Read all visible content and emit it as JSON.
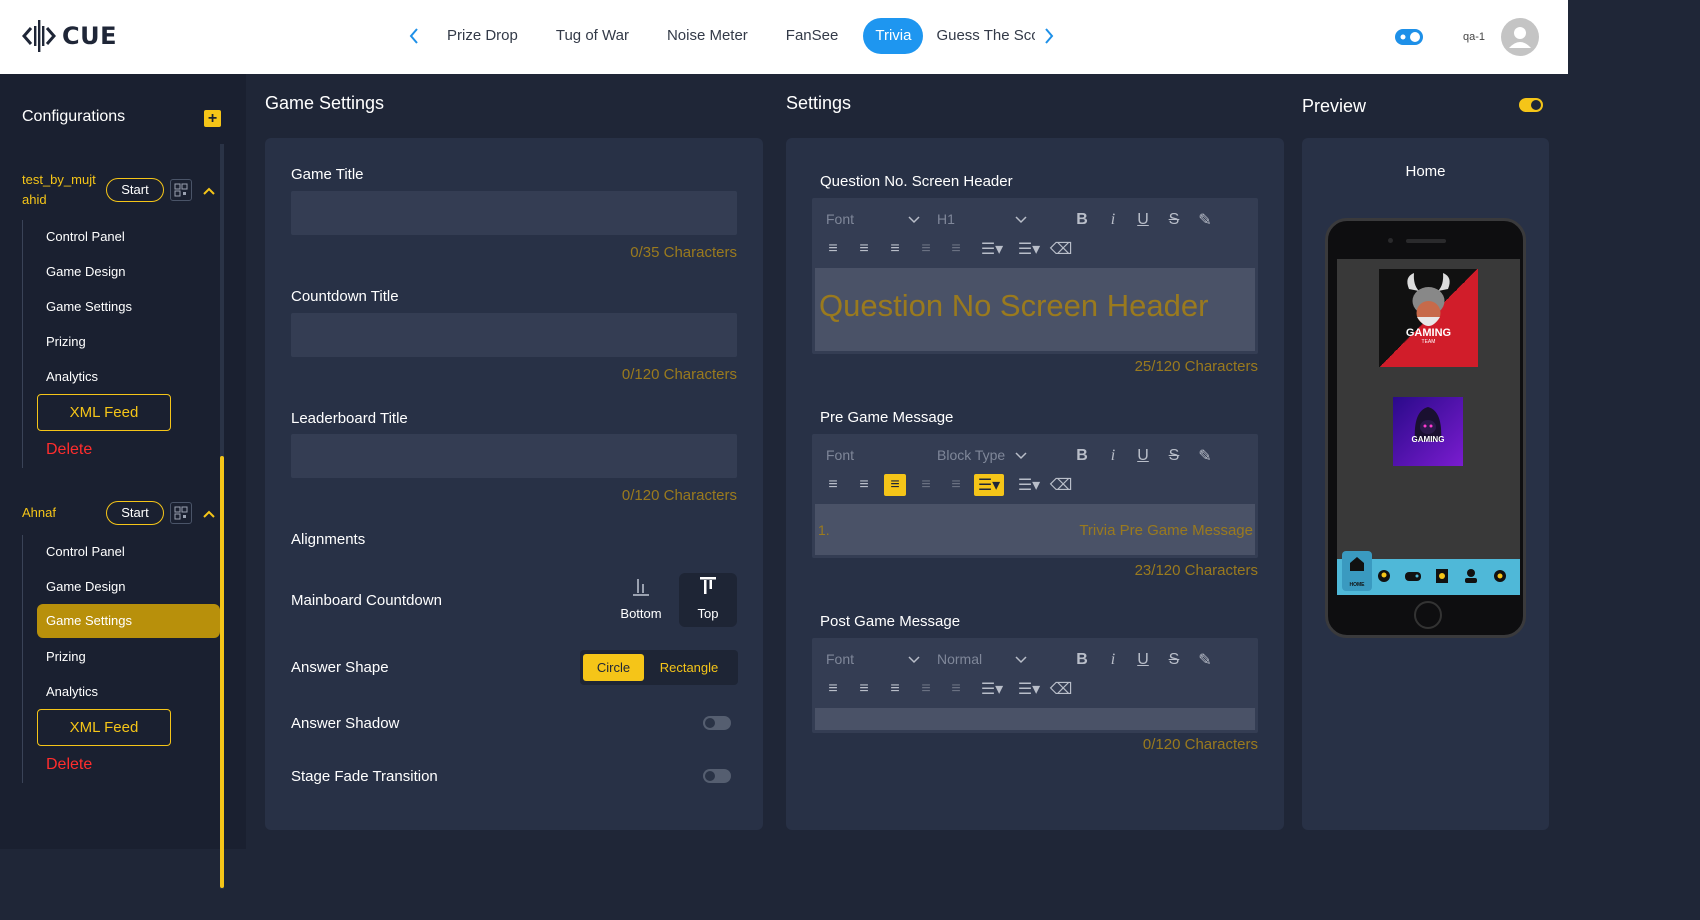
{
  "header": {
    "logo_text": "CUE",
    "tabs": [
      {
        "label": "Prize Drop"
      },
      {
        "label": "Tug of War"
      },
      {
        "label": "Noise Meter"
      },
      {
        "label": "FanSee"
      },
      {
        "label": "Trivia",
        "active": true
      },
      {
        "label": "Guess The Score"
      }
    ],
    "user": "qa-1",
    "accent": "#1e96f0"
  },
  "sidebar": {
    "title": "Configurations",
    "configs": [
      {
        "name": "test_by_mujt ahid",
        "name_line1": "test_by_mujt",
        "name_line2": "ahid",
        "start_label": "Start",
        "items": [
          "Control Panel",
          "Game Design",
          "Game Settings",
          "Prizing",
          "Analytics"
        ],
        "xml_label": "XML Feed",
        "delete_label": "Delete"
      },
      {
        "name": "Ahnaf",
        "start_label": "Start",
        "items": [
          "Control Panel",
          "Game Design",
          "Game Settings",
          "Prizing",
          "Analytics"
        ],
        "active_item": "Game Settings",
        "xml_label": "XML Feed",
        "delete_label": "Delete"
      }
    ]
  },
  "game_settings": {
    "title": "Game Settings",
    "game_title": {
      "label": "Game Title",
      "value": "",
      "count": "0/35 Characters"
    },
    "countdown_title": {
      "label": "Countdown Title",
      "value": "",
      "count": "0/120 Characters"
    },
    "leaderboard_title": {
      "label": "Leaderboard Title",
      "value": "",
      "count": "0/120 Characters"
    },
    "alignments_label": "Alignments",
    "mainboard_countdown": {
      "label": "Mainboard Countdown",
      "options": [
        "Bottom",
        "Top"
      ],
      "selected": "Top"
    },
    "answer_shape": {
      "label": "Answer Shape",
      "options": [
        "Circle",
        "Rectangle"
      ],
      "selected": "Circle"
    },
    "answer_shadow": {
      "label": "Answer Shadow",
      "enabled": false
    },
    "stage_fade": {
      "label": "Stage Fade Transition",
      "enabled": false
    }
  },
  "settings": {
    "title": "Settings",
    "question_header": {
      "label": "Question No. Screen Header",
      "font": "Font",
      "block": "H1",
      "content": "Question No Screen Header",
      "count": "25/120 Characters"
    },
    "pre_game": {
      "label": "Pre Game Message",
      "font": "Font",
      "block": "Block Type",
      "list_number": "1.",
      "content": "Trivia Pre Game Message",
      "count": "23/120 Characters"
    },
    "post_game": {
      "label": "Post Game Message",
      "font": "Font",
      "block": "Normal",
      "content": "",
      "count": "0/120 Characters"
    }
  },
  "preview": {
    "title": "Preview",
    "screen_title": "Home",
    "logo1_text": "GAMING",
    "logo1_sub": "TEAM",
    "logo2_text": "GAMING",
    "nav_home": "HOME"
  }
}
